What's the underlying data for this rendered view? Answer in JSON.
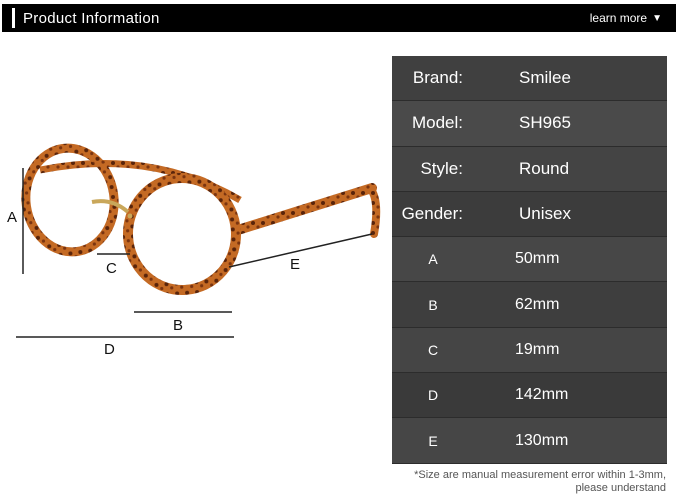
{
  "header": {
    "title": "Product Information",
    "learn_more": "learn more",
    "caret": "▼"
  },
  "figure": {
    "labels": {
      "a": "A",
      "b": "B",
      "c": "C",
      "d": "D",
      "e": "E"
    }
  },
  "specs": [
    {
      "label": "Brand:",
      "value": "Smilee"
    },
    {
      "label": "Model:",
      "value": "SH965"
    },
    {
      "label": "Style:",
      "value": "Round"
    },
    {
      "label": "Gender:",
      "value": "Unisex"
    },
    {
      "label": "A",
      "value": "50mm"
    },
    {
      "label": "B",
      "value": "62mm"
    },
    {
      "label": "C",
      "value": "19mm"
    },
    {
      "label": "D",
      "value": "142mm"
    },
    {
      "label": "E",
      "value": "130mm"
    }
  ],
  "note": {
    "line1": "*Size are manual measurement error within 1-3mm,",
    "line2": "please understand"
  },
  "colors": {
    "frame": "#8a3d12",
    "frame_light": "#c46a24",
    "bridge": "#c9a75a",
    "header_bg": "#000000"
  }
}
